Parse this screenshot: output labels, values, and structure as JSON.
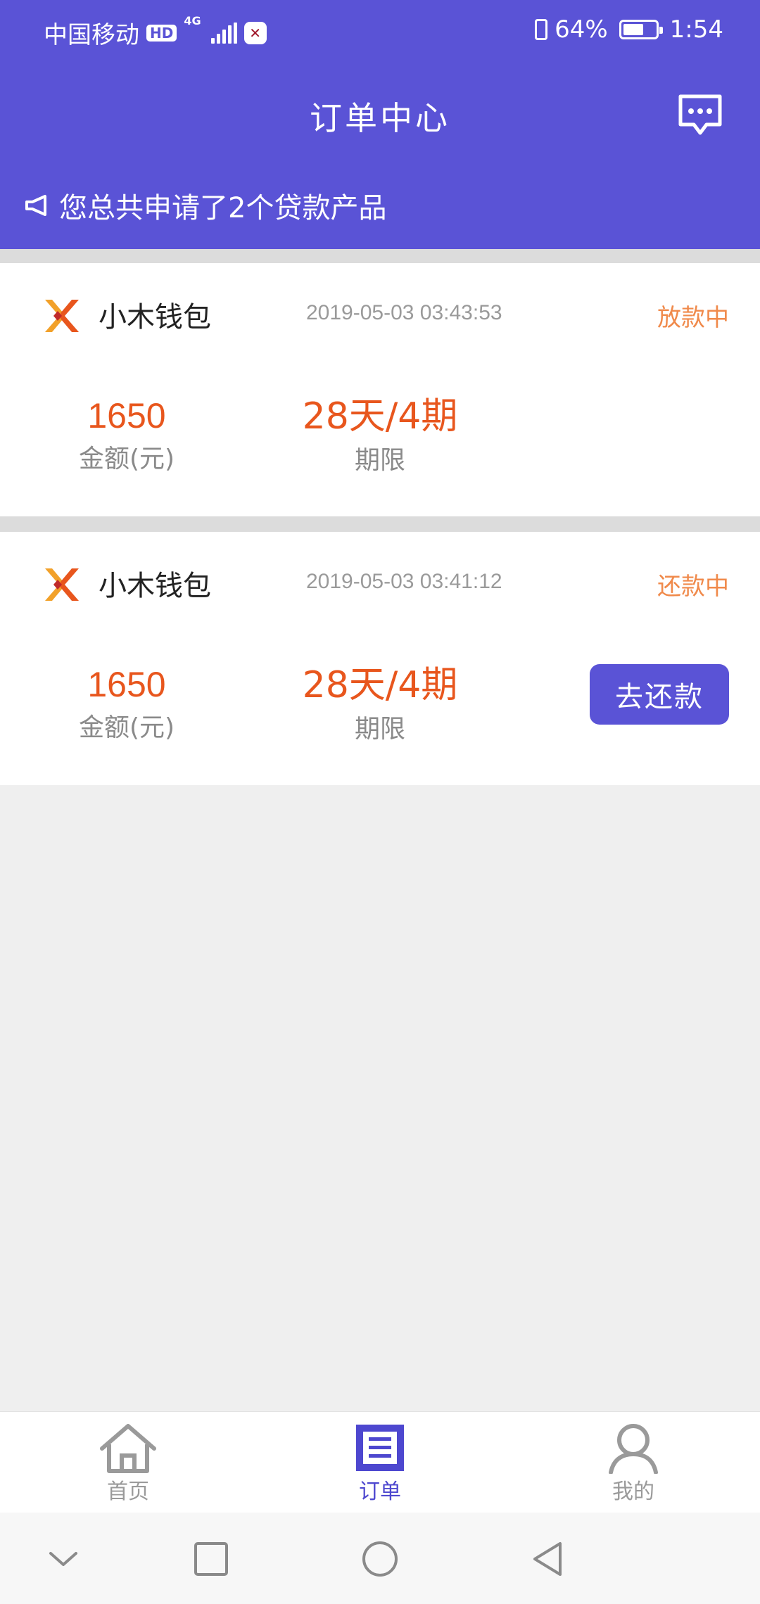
{
  "status_bar": {
    "carrier": "中国移动",
    "hd": "HD",
    "network": "4G",
    "battery_percent": "64%",
    "battery_level": 0.64,
    "time": "1:54"
  },
  "header": {
    "title": "订单中心",
    "notice": "您总共申请了2个贷款产品",
    "bg_color": "#5a53d6"
  },
  "orders": [
    {
      "product": "小木钱包",
      "timestamp": "2019-05-03 03:43:53",
      "status": "放款中",
      "amount": "1650",
      "amount_label": "金额(元)",
      "term": "28天/4期",
      "term_label": "期限"
    },
    {
      "product": "小木钱包",
      "timestamp": "2019-05-03 03:41:12",
      "status": "还款中",
      "amount": "1650",
      "amount_label": "金额(元)",
      "term": "28天/4期",
      "term_label": "期限",
      "action_label": "去还款"
    }
  ],
  "tabbar": {
    "home": "首页",
    "orders": "订单",
    "mine": "我的",
    "active": "orders"
  },
  "icons": {
    "message": "chat-bubble-icon",
    "notice": "megaphone-icon",
    "home": "home-icon",
    "orders": "document-icon",
    "mine": "user-icon",
    "nav_down": "chevron-down-icon",
    "nav_recent": "square-icon",
    "nav_home": "circle-icon",
    "nav_back": "triangle-back-icon"
  }
}
